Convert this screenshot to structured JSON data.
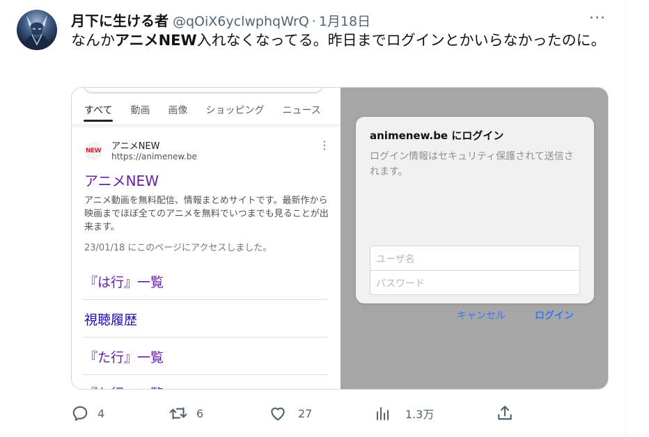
{
  "tweet": {
    "display_name": "月下に生ける者",
    "handle": "@qOiX6yclwphqWrQ",
    "separator": "·",
    "date": "1月18日",
    "more": "···",
    "text": {
      "part1": "なんか",
      "bold": "アニメNEW",
      "part2": "入れなくなってる。昨日までログインとかいらなかったのに。"
    }
  },
  "screenshot_left": {
    "tabs": [
      "すべて",
      "動画",
      "画像",
      "ショッピング",
      "ニュース"
    ],
    "result": {
      "logo_text": "NEW",
      "site_name": "アニメNEW",
      "url": "https://animenew.be",
      "menu_icon": "⋮",
      "title": "アニメNEW",
      "snippet": "アニメ動画を無料配信、情報まとめサイトです。最新作から映画までほぼ全てのアニメを無料でいつまでも見ることが出来ます。",
      "visited": "23/01/18 にこのページにアクセスしました。"
    },
    "sitelinks": [
      "『は行』一覧",
      "視聴履歴",
      "『た行』一覧",
      "『わ行』一覧"
    ]
  },
  "screenshot_right": {
    "dialog": {
      "title": "animenew.be にログイン",
      "message": "ログイン情報はセキュリティ保護されて送信されます。",
      "username_placeholder": "ユーザ名",
      "password_placeholder": "パスワード",
      "cancel": "キャンセル",
      "login": "ログイン"
    }
  },
  "actions": {
    "reply_count": "4",
    "retweet_count": "6",
    "like_count": "27",
    "views_count": "1.3万"
  },
  "colors": {
    "link_visited": "#681da8",
    "link_blue": "#1a0dab",
    "ios_blue": "#3478f6",
    "overlay_gray": "#a6a6a6"
  },
  "icons": [
    "reply-icon",
    "retweet-icon",
    "like-icon",
    "views-icon",
    "share-icon",
    "more-icon"
  ]
}
